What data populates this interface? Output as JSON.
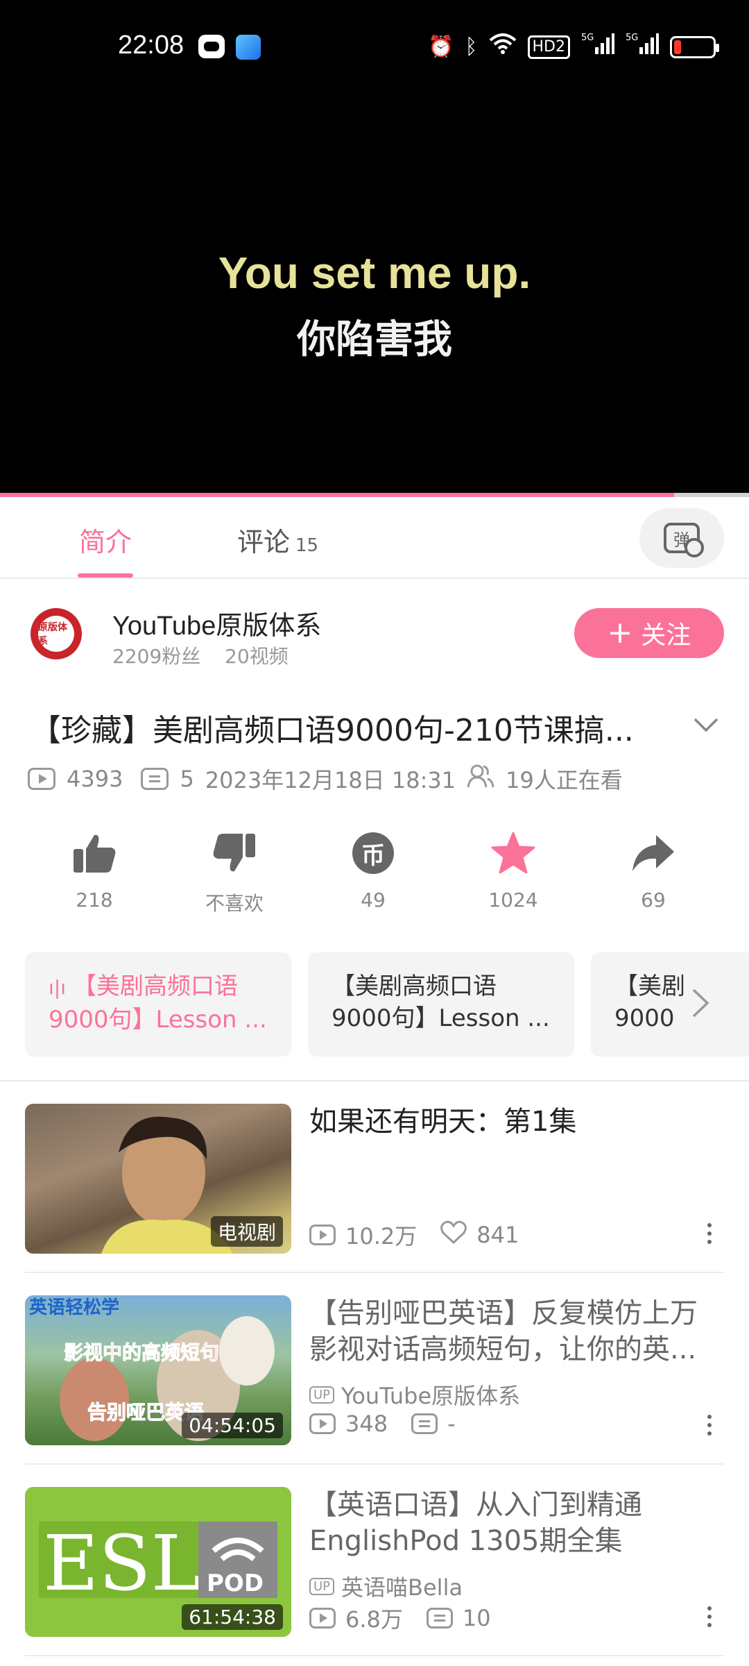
{
  "status_bar": {
    "time": "22:08",
    "icons": [
      "alarm-icon",
      "bluetooth-icon",
      "wifi-icon",
      "hd-icon",
      "signal-5g-icon",
      "signal-5g-icon",
      "battery-icon"
    ],
    "hd_label": "HD2",
    "signal_label": "5G",
    "battery_color": "#ff3b30"
  },
  "player": {
    "subtitle_en": "You set me up.",
    "subtitle_zh": "你陷害我",
    "progress": 0.9
  },
  "tabs": {
    "intro": "简介",
    "comments": "评论",
    "comments_count": "15",
    "danmu_label": "弹"
  },
  "uploader": {
    "avatar_text": "原版体系",
    "name": "YouTube原版体系",
    "fans": "2209粉丝",
    "videos": "20视频",
    "follow_label": "关注",
    "follow_plus": "+"
  },
  "video": {
    "title": "【珍藏】美剧高频口语9000句-210节课搞...",
    "plays": "4393",
    "danmaku": "5",
    "date": "2023年12月18日 18:31",
    "watching": "19人正在看"
  },
  "actions": {
    "like": "218",
    "dislike": "不喜欢",
    "coin": "49",
    "favorite": "1024",
    "share": "69",
    "coin_symbol": "币"
  },
  "episodes": [
    {
      "line1": "【美剧高频口语",
      "line2": "9000句】Lesson ..."
    },
    {
      "line1": "【美剧高频口语",
      "line2": "9000句】Lesson ..."
    },
    {
      "line1": "【美剧",
      "line2": "9000"
    }
  ],
  "recommendations": [
    {
      "title": "如果还有明天：第1集",
      "badge": "电视剧",
      "plays": "10.2万",
      "likes": "841"
    },
    {
      "title": "【告别哑巴英语】反复模仿上万影视对话高频短句，让你的英...",
      "duration": "04:54:05",
      "owner": "YouTube原版体系",
      "plays": "348",
      "danmaku": "-",
      "thumb_top": "英语轻松学",
      "thumb_mid": "影视中的高频短句",
      "thumb_bot": "告别哑巴英语"
    },
    {
      "title": "【英语口语】从入门到精通EnglishPod 1305期全集",
      "duration": "61:54:38",
      "owner": "英语喵Bella",
      "plays": "6.8万",
      "danmaku": "10",
      "thumb_logo": "ESL",
      "thumb_pod": "POD"
    }
  ],
  "up_tag": "UP",
  "colors": {
    "accent": "#fb7299",
    "text_gray": "#888888"
  }
}
